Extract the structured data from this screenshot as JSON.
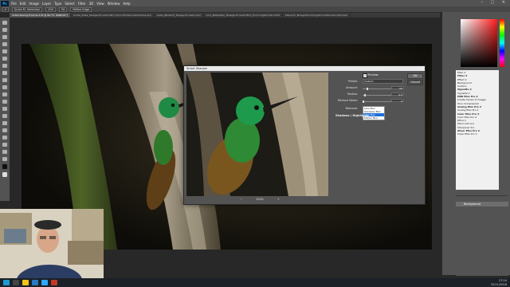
{
  "app": {
    "logo": "Ps",
    "menu": [
      "File",
      "Edit",
      "Image",
      "Layer",
      "Type",
      "Select",
      "Filter",
      "3D",
      "View",
      "Window",
      "Help"
    ]
  },
  "options": {
    "mode": "Quick M. Selection",
    "size": "100",
    "tolerance": "50",
    "refine": "Refine Edge"
  },
  "tabs": [
    "Antler-Racing-Tropical-2.tif @ 66.7% (RGB/16*)",
    "Andre_Salza_Tanager-Ecuador-Bird_Hum-Ulmitex-AdvGamma.psd",
    "Lewis_Bluebird_Tanager-Ecuador.psd",
    "Lucy_BabyNeko_Tanager-Ecuador-Bird_Hummingbird-KP-14.tif",
    "Mansinti_TanagerHummingbird-AntEcuador-Bird.psd"
  ],
  "dialog": {
    "title": "Smart Sharpen",
    "preview_label": "Preview",
    "preset_label": "Preset:",
    "preset_value": "Custom",
    "amount_label": "Amount:",
    "amount_value": "55",
    "radius_label": "Radius:",
    "radius_value": "0.5",
    "reduce_noise_label": "Reduce Noise:",
    "reduce_noise_value": "0",
    "remove_label": "Remove:",
    "remove_options": [
      "Lens Blur",
      "Gaussian Blur",
      "Lens Blur",
      "Motion Blur"
    ],
    "remove_selected": "Lens Blur",
    "shadows_label": "Shadows / Highlights",
    "ok": "OK",
    "cancel": "Cancel",
    "zoom": "100%",
    "zoom_out": "−",
    "zoom_in": "+"
  },
  "filters_panel": {
    "items": [
      {
        "t": "Filter 2",
        "b": false
      },
      {
        "t": "Filter 2",
        "b": true
      },
      {
        "t": "Effect 2",
        "b": false
      },
      {
        "t": "Background",
        "b": false
      },
      {
        "t": "Surface",
        "b": false
      },
      {
        "t": "Vignette 2",
        "b": true
      },
      {
        "t": "Vignette 2",
        "b": false
      },
      {
        "t": "HDR Efex Pro 2",
        "b": true
      },
      {
        "t": "Create Series of Images",
        "b": false
      },
      {
        "t": "Tone Compression",
        "b": false
      },
      {
        "t": "Analog Efex Pro 2",
        "b": true
      },
      {
        "t": "Analog Efex Pro 2",
        "b": false
      },
      {
        "t": "Color Efex Pro 4",
        "b": true
      },
      {
        "t": "Color Efex Pro 4",
        "b": false
      },
      {
        "t": "Dfine 2",
        "b": false
      },
      {
        "t": "Place add-ons",
        "b": false
      },
      {
        "t": "Sharpener Pro",
        "b": false
      },
      {
        "t": "Silver Efex Pro 2",
        "b": true
      },
      {
        "t": "Silver Efex Pro 2",
        "b": false
      }
    ]
  },
  "layers": {
    "layer_name": "Background"
  },
  "taskbar": {
    "time": "17:24",
    "date": "22/11/2016"
  },
  "colors": {
    "accent": "#1e6fd9",
    "ps_brand": "#31a8ff",
    "ui_panel": "#535353"
  }
}
